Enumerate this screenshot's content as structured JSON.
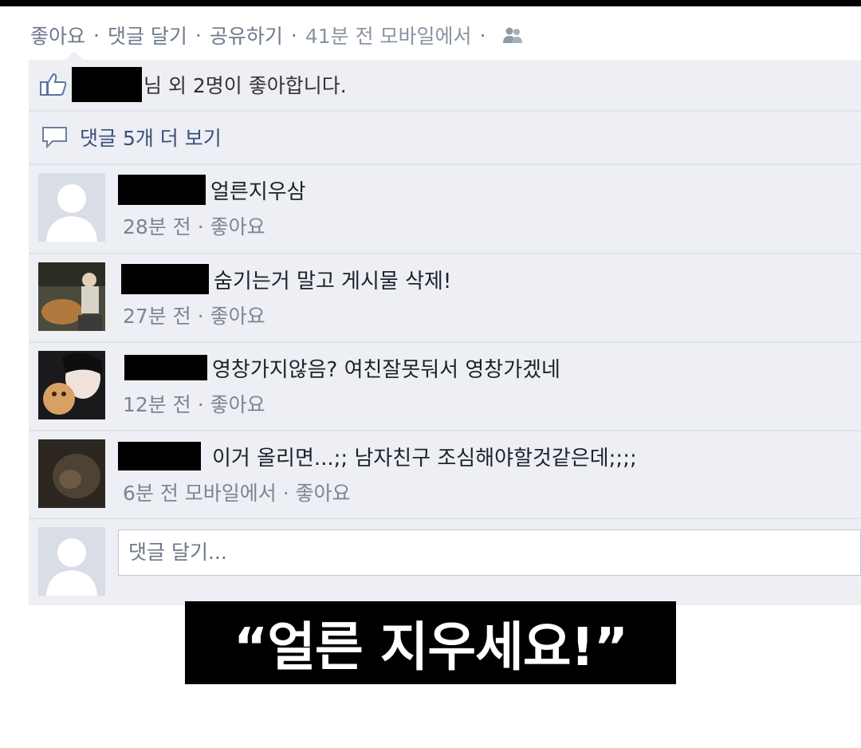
{
  "actions": {
    "like": "좋아요",
    "comment": "댓글 달기",
    "share": "공유하기",
    "posted": "41분 전 모바일에서",
    "separator": "·",
    "audience_icon": "people-icon"
  },
  "likes": {
    "text": "님 외 2명이 좋아합니다.",
    "icon": "thumbs-up-icon"
  },
  "more_comments": {
    "text": "댓글 5개 더 보기",
    "icon": "speech-bubble-icon"
  },
  "comments": [
    {
      "text": "얼른지우삼",
      "meta": "28분 전 ·",
      "like": "좋아요",
      "avatar": "default-avatar"
    },
    {
      "text": "숨기는거 말고 게시물 삭제!",
      "meta": "27분 전 ·",
      "like": "좋아요",
      "avatar": "photo-avatar"
    },
    {
      "text": "영창가지않음? 여친잘못둬서 영창가겠네",
      "meta": "12분 전 ·",
      "like": "좋아요",
      "avatar": "photo-avatar"
    },
    {
      "text": "이거 올리면...;; 남자친구 조심해야할것같은데;;;;",
      "meta": "6분 전 모바일에서 ·",
      "like": "좋아요",
      "avatar": "photo-avatar"
    }
  ],
  "composer": {
    "placeholder": "댓글 달기..."
  },
  "caption": {
    "text": "“얼른 지우세요!”"
  },
  "colors": {
    "panel": "#edeff4",
    "link": "#3b4f7b",
    "meta": "#7b8595",
    "caption_bg": "#000000"
  }
}
